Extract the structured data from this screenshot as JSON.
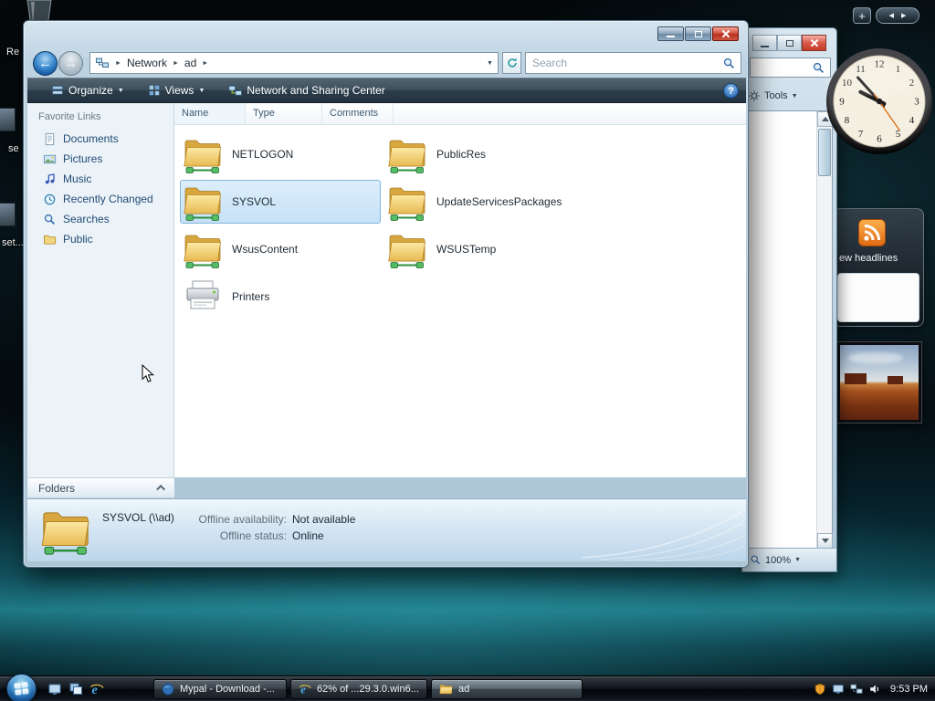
{
  "desktop": {
    "fragments": {
      "f1": "Re",
      "f2": "se",
      "f3": "set..."
    }
  },
  "gadgets": {
    "clock": {
      "numerals": [
        "12",
        "1",
        "2",
        "3",
        "4",
        "5",
        "6",
        "7",
        "8",
        "9",
        "10",
        "11"
      ],
      "time": "9:53"
    },
    "feed": {
      "headline": "ew headlines"
    }
  },
  "ie_window": {
    "tools_label": "Tools",
    "zoom_label": "100%"
  },
  "explorer": {
    "breadcrumb": {
      "root": "Network",
      "current": "ad"
    },
    "search": {
      "placeholder": "Search"
    },
    "toolbar": {
      "organize": "Organize",
      "views": "Views",
      "network_sharing": "Network and Sharing Center"
    },
    "columns": [
      "Name",
      "Type",
      "Comments"
    ],
    "favorites": {
      "title": "Favorite Links",
      "items": [
        {
          "label": "Documents"
        },
        {
          "label": "Pictures"
        },
        {
          "label": "Music"
        },
        {
          "label": "Recently Changed"
        },
        {
          "label": "Searches"
        },
        {
          "label": "Public"
        }
      ]
    },
    "folders_label": "Folders",
    "files": [
      {
        "name": "NETLOGON",
        "selected": false
      },
      {
        "name": "PublicRes",
        "selected": false
      },
      {
        "name": "SYSVOL",
        "selected": true
      },
      {
        "name": "UpdateServicesPackages",
        "selected": false
      },
      {
        "name": "WsusContent",
        "selected": false
      },
      {
        "name": "WSUSTemp",
        "selected": false
      },
      {
        "name": "Printers",
        "selected": false
      }
    ],
    "details": {
      "title": "SYSVOL (\\\\ad)",
      "rows": [
        {
          "label": "Offline availability:",
          "value": "Not available"
        },
        {
          "label": "Offline status:",
          "value": "Online"
        }
      ]
    }
  },
  "taskbar": {
    "buttons": [
      {
        "label": "Mypal - Download -..."
      },
      {
        "label": "62% of ...29.3.0.win6..."
      },
      {
        "label": "ad"
      }
    ],
    "clock": "9:53 PM"
  }
}
